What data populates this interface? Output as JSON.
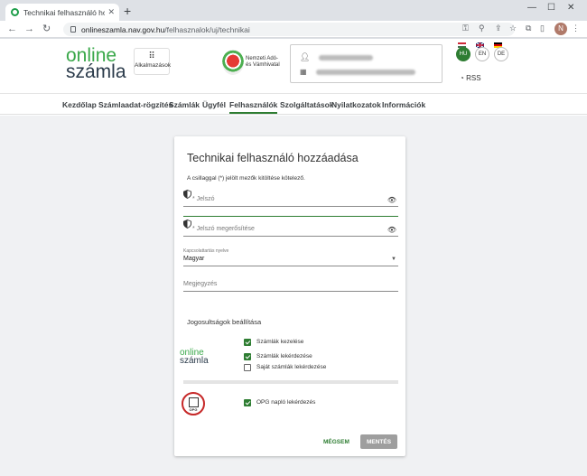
{
  "browser": {
    "tab_title": "Technikai felhasználó hozzáadása",
    "url_host": "onlineszamla.nav.gov.hu",
    "url_path": "/felhasznalok/uj/technikai",
    "profile_initial": "N"
  },
  "header": {
    "logo_online": "online",
    "logo_szamla": "számla",
    "apps_label": "Alkalmazások",
    "nav_name_line1": "Nemzeti Adó-",
    "nav_name_line2": "és Vámhivatal",
    "languages": [
      "HU",
      "EN",
      "DE"
    ],
    "active_language": "HU",
    "rss_label": "RSS"
  },
  "menu": {
    "items": [
      "Kezdőlap",
      "Számlaadat-rögzítés",
      "Számlák",
      "Ügyfél",
      "Felhasználók",
      "Szolgáltatások",
      "Nyilatkozatok",
      "Információk"
    ],
    "active": "Felhasználók"
  },
  "form": {
    "title": "Technikai felhasználó hozzáadása",
    "required_note": "A csillaggal (*) jelölt mezők kitöltése kötelező.",
    "password_placeholder": "* Jelszó",
    "password_confirm_placeholder": "* Jelszó megerősítése",
    "language_label": "Kapcsolattartás nyelve",
    "language_value": "Magyar",
    "note_placeholder": "Megjegyzés",
    "permissions_title": "Jogosultságok beállítása",
    "permissions": [
      {
        "label": "Számlák kezelése",
        "checked": true
      },
      {
        "label": "Számlák lekérdezése",
        "checked": true
      },
      {
        "label": "Saját számlák lekérdezése",
        "checked": false
      }
    ],
    "opg_icon_text": "OPG",
    "opg_permission": {
      "label": "OPG napló lekérdezés",
      "checked": true
    },
    "cancel_label": "MÉGSEM",
    "save_label": "MENTÉS"
  },
  "colors": {
    "accent": "#2e7d32",
    "logo_green": "#3aa84a",
    "save_disabled": "#9e9e9e"
  }
}
